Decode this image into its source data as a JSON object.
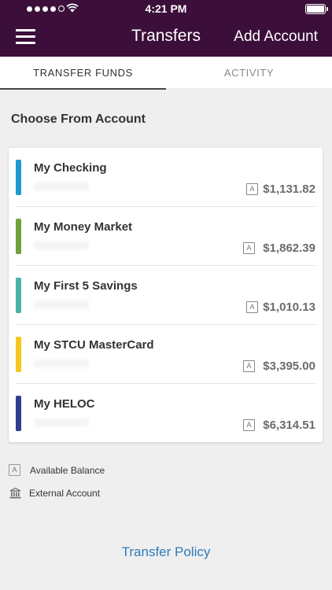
{
  "status_bar": {
    "time": "4:21 PM"
  },
  "nav": {
    "title": "Transfers",
    "action_label": "Add Account"
  },
  "tabs": [
    {
      "label": "TRANSFER FUNDS",
      "active": true
    },
    {
      "label": "ACTIVITY",
      "active": false
    }
  ],
  "section_title": "Choose From Account",
  "accounts": [
    {
      "name": "My Checking",
      "balance": "$1,131.82",
      "color": "#1b9bd1"
    },
    {
      "name": "My Money Market",
      "balance": "$1,862.39",
      "color": "#6fa33a"
    },
    {
      "name": "My First 5 Savings",
      "balance": "$1,010.13",
      "color": "#4bb3a9"
    },
    {
      "name": "My STCU MasterCard",
      "balance": "$3,395.00",
      "color": "#f6c61c"
    },
    {
      "name": "My HELOC",
      "balance": "$6,314.51",
      "color": "#2e3e8f"
    }
  ],
  "balance_marker": "A",
  "legend": {
    "available_marker": "A",
    "available_label": "Available Balance",
    "external_label": "External Account"
  },
  "policy_link": "Transfer Policy"
}
